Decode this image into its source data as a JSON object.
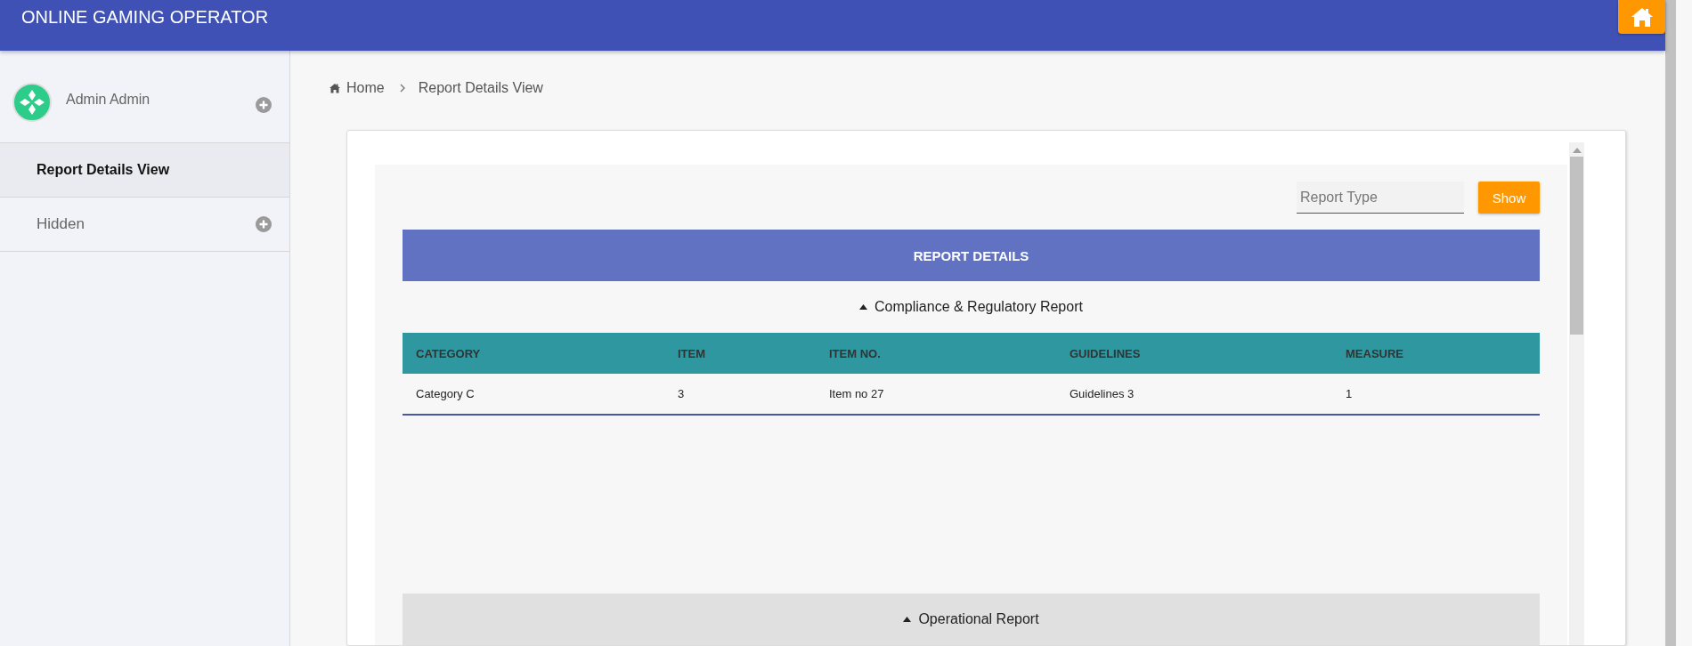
{
  "header": {
    "title": "ONLINE GAMING OPERATOR"
  },
  "sidebar": {
    "user": {
      "name": "Admin Admin"
    },
    "items": [
      {
        "label": "Report Details View",
        "selected": true,
        "expandable": false
      },
      {
        "label": "Hidden",
        "selected": false,
        "expandable": true
      }
    ]
  },
  "breadcrumb": [
    "Home",
    "Report Details View"
  ],
  "filter": {
    "placeholder": "Report Type",
    "button": "Show"
  },
  "report_title": "REPORT DETAILS",
  "sections": [
    {
      "title": "Compliance & Regulatory Report",
      "selected": false,
      "table": {
        "columns": [
          "CATEGORY",
          "ITEM",
          "ITEM NO.",
          "GUIDELINES",
          "MEASURE"
        ],
        "rows": [
          [
            "Category C",
            "3",
            "Item no 27",
            "Guidelines 3",
            "1"
          ]
        ]
      }
    },
    {
      "title": "Operational Report",
      "selected": true
    }
  ]
}
